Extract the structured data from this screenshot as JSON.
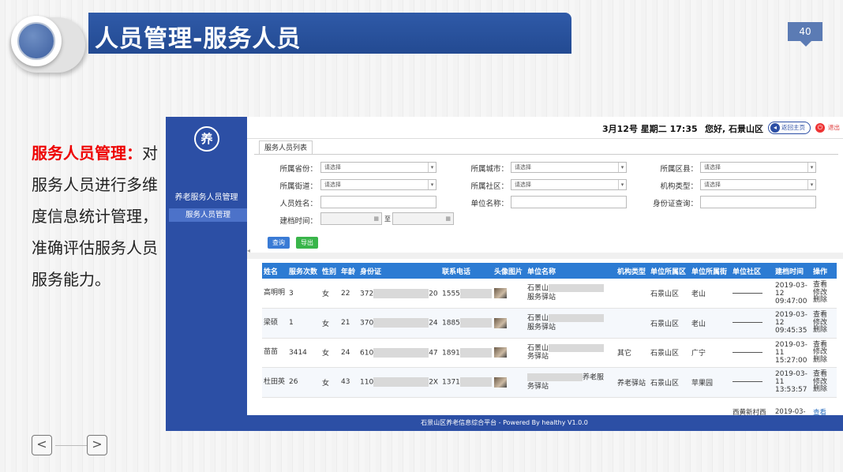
{
  "slide": {
    "title": "人员管理-服务人员",
    "page_number": "40",
    "desc_title": "服务人员管理：",
    "desc_body": "对服务人员进行多维度信息统计管理，准确评估服务人员服务能力。",
    "prev_label": "<",
    "next_label": ">"
  },
  "app": {
    "logo_text": "养",
    "sidebar_group": "养老服务人员管理",
    "sidebar_item": "服务人员管理",
    "date_time": "3月12号 星期二 17:35",
    "greeting": "您好, 石景山区",
    "home_button": "返回主页",
    "exit_button": "退出",
    "tab_label": "服务人员列表",
    "footer_text": "石景山区养老信息综合平台 - Powered By healthy V1.0.0",
    "collapse_icon": "◂"
  },
  "filters": {
    "province_label": "所属省份：",
    "city_label": "所属城市：",
    "county_label": "所属区县：",
    "street_label": "所属街道：",
    "community_label": "所属社区：",
    "org_type_label": "机构类型：",
    "name_label": "人员姓名：",
    "unit_name_label": "单位名称：",
    "id_query_label": "身份证查询：",
    "filing_time_label": "建档时间：",
    "to_label": "至",
    "select_placeholder": "请选择",
    "dropdown_arrow": "▾",
    "calendar_icon": "▦",
    "query_button": "查询",
    "export_button": "导出"
  },
  "table": {
    "headers": [
      "姓名",
      "服务次数",
      "性别",
      "年龄",
      "身份证",
      "联系电话",
      "头像图片",
      "单位名称",
      "机构类型",
      "单位所属区",
      "单位所属街",
      "单位社区",
      "建档时间",
      "操作"
    ],
    "op_view": "查看",
    "op_edit": "修改",
    "op_delete": "删除",
    "rows": [
      {
        "name": "高明明",
        "count": "3",
        "gender": "女",
        "age": "22",
        "id_pre": "372",
        "id_suf": "20",
        "phone": "1555",
        "unit1": "石景山",
        "unit2": "服务驿站",
        "type": "",
        "district": "石景山区",
        "street": "老山",
        "time": "2019-03-12 09:47:00"
      },
      {
        "name": "梁硕",
        "count": "1",
        "gender": "女",
        "age": "21",
        "id_pre": "370",
        "id_suf": "24",
        "phone": "1885",
        "unit1": "石景山",
        "unit2": "服务驿站",
        "type": "",
        "district": "石景山区",
        "street": "老山",
        "time": "2019-03-12 09:45:35"
      },
      {
        "name": "苗苗",
        "count": "3414",
        "gender": "女",
        "age": "24",
        "id_pre": "610",
        "id_suf": "47",
        "phone": "1891",
        "unit1": "石景山",
        "unit2": "务驿站",
        "type": "其它",
        "district": "石景山区",
        "street": "广宁",
        "time": "2019-03-11 15:27:00"
      },
      {
        "name": "杜田英",
        "count": "26",
        "gender": "女",
        "age": "43",
        "id_pre": "110",
        "id_suf": "2X",
        "phone": "1371",
        "unit1": "养老服",
        "unit2": "务驿站",
        "type": "养老驿站",
        "district": "石景山区",
        "street": "苹果园",
        "time": "2019-03-11 13:53:57"
      }
    ],
    "partial_community": "西黄新村西",
    "partial_time": "2019-03-"
  }
}
